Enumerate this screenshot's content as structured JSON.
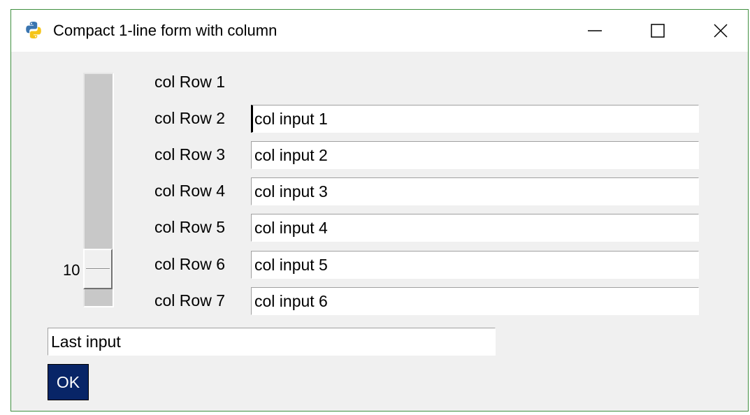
{
  "window": {
    "title": "Compact 1-line form with column",
    "icon": "python-icon",
    "border_color": "#3f8f3f"
  },
  "titlebar_buttons": {
    "minimize": "minimize-icon",
    "maximize": "maximize-icon",
    "close": "close-icon"
  },
  "slider": {
    "value": "10",
    "range": [
      1,
      100
    ],
    "level": 10
  },
  "rows": [
    {
      "label": "col Row 1"
    },
    {
      "label": "col Row 2",
      "value": "col input 1"
    },
    {
      "label": "col Row 3",
      "value": "col input 2"
    },
    {
      "label": "col Row 4",
      "value": "col input 3"
    },
    {
      "label": "col Row 5",
      "value": "col input 4"
    },
    {
      "label": "col Row 6",
      "value": "col input 5"
    },
    {
      "label": "col Row 7",
      "value": "col input 6"
    }
  ],
  "last_input": {
    "value": "Last input"
  },
  "ok_button": {
    "label": "OK",
    "background": "#082567"
  }
}
